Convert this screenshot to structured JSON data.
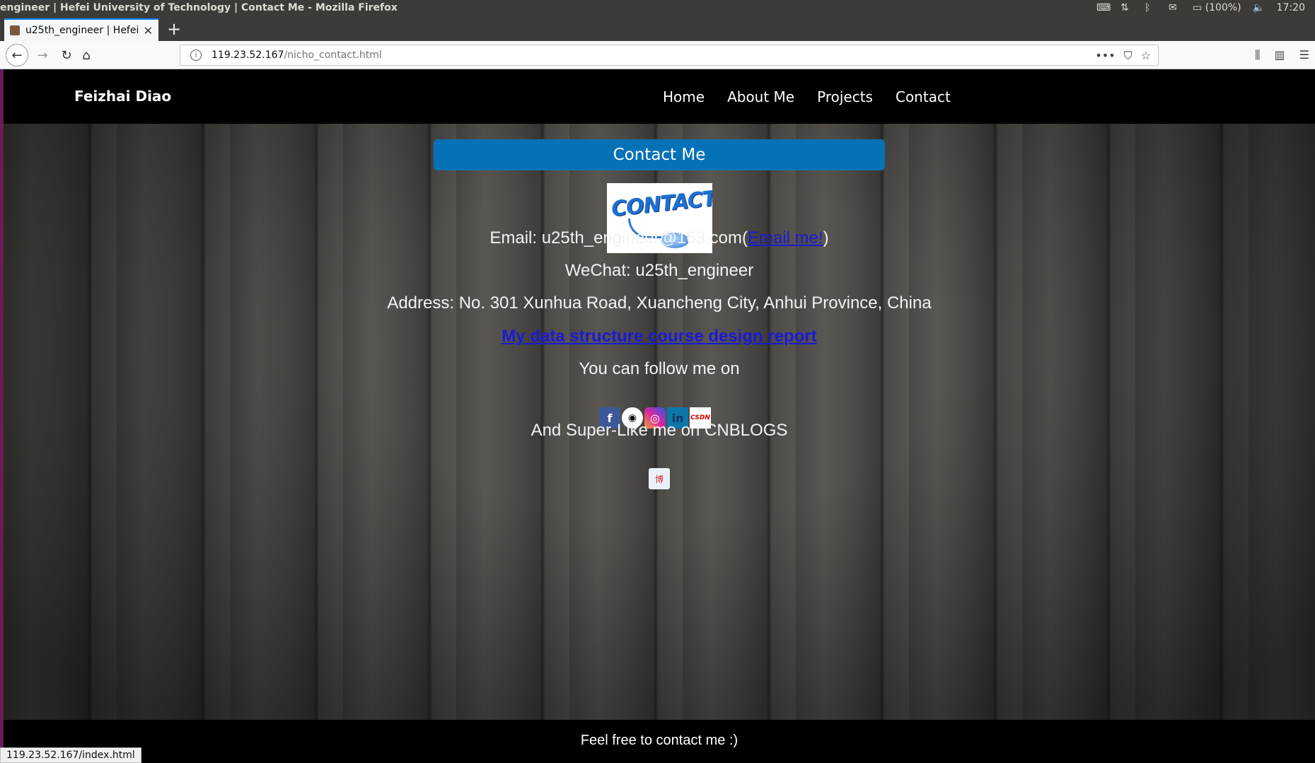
{
  "system": {
    "window_title": "engineer | Hefei University of Technology | Contact Me - Mozilla Firefox",
    "battery": "(100%)",
    "clock": "17:20"
  },
  "browser": {
    "tab_title": "u25th_engineer | Hefei U",
    "url_host": "119.23.52.167",
    "url_path": "/nicho_contact.html",
    "status_url": "119.23.52.167/index.html"
  },
  "site": {
    "brand": "Feizhai Diao",
    "nav": [
      "Home",
      "About Me",
      "Projects",
      "Contact"
    ],
    "contact_button": "Contact Me",
    "contact_image_text": "CONTACT",
    "email_text": "Email: u25th_engineer@163.com(",
    "email_link": "Email me!",
    "email_close": ")",
    "wechat": "WeChat: u25th_engineer",
    "address": "Address: No. 301 Xunhua Road, Xuancheng City, Anhui Province, China",
    "report_link": "My data structure course design report",
    "follow_text": "You can follow me on",
    "social_icons": [
      "facebook-icon",
      "github-icon",
      "instagram-icon",
      "linkedin-icon",
      "csdn-icon"
    ],
    "csdn_label": "CSDN",
    "cnblogs_text": "And Super-Like me on CNBLOGS",
    "footer": "Feel free to contact me :)"
  }
}
